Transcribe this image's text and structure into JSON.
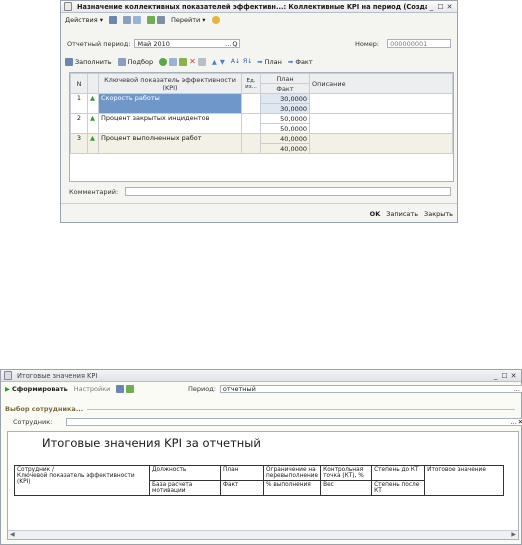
{
  "win1": {
    "title": "Назначение коллективных показателей эффективн...: Коллективные KPI на период (Создание) *",
    "toolbar": {
      "actions": "Действия",
      "goto": "Перейти"
    },
    "period_label": "Отчетный период:",
    "period_value": "Май 2010",
    "number_label": "Номер:",
    "number_value": "000000001",
    "table_toolbar": {
      "fill": "Заполнить",
      "select": "Подбор",
      "plan": "План",
      "fact": "Факт"
    },
    "columns": {
      "n": "N",
      "kpi": "Ключевой показатель эффективности (KPI)",
      "unit": "Ед. из...",
      "plan": "План",
      "fact": "Факт",
      "description": "Описание"
    },
    "rows": [
      {
        "n": "1",
        "kpi": "Скорость работы",
        "plan": "30,0000",
        "fact": "30,0000"
      },
      {
        "n": "2",
        "kpi": "Процент закрытых инцидентов",
        "plan": "50,0000",
        "fact": "50,0000"
      },
      {
        "n": "3",
        "kpi": "Процент выполненных работ",
        "plan": "40,0000",
        "fact": "40,0000"
      }
    ],
    "comment_label": "Комментарий:",
    "buttons": {
      "ok": "OK",
      "save": "Записать",
      "close": "Закрыть"
    }
  },
  "win2": {
    "title": "Итоговые значения KPI",
    "toolbar": {
      "generate": "Сформировать",
      "settings": "Настройки"
    },
    "period_label": "Период:",
    "period_value": "отчетный",
    "group_label": "Выбор сотрудника...",
    "employee_label": "Сотрудник:",
    "report_title": "Итоговые значения KPI за отчетный",
    "report_headers": {
      "employee": "Сотрудник /",
      "kpi": "Ключевой показатель эффективности (KPI)",
      "position": "Должность",
      "base": "База расчета мотивации",
      "plan": "План",
      "fact": "Факт",
      "limit": "Ограничение на перевыполнение",
      "percent": "% выполнения",
      "checkpoint": "Контрольная точка (КТ), %",
      "weight": "Вес",
      "degree_before": "Степень до КТ",
      "degree_after": "Степень после КТ",
      "total": "Итоговое значение"
    }
  }
}
